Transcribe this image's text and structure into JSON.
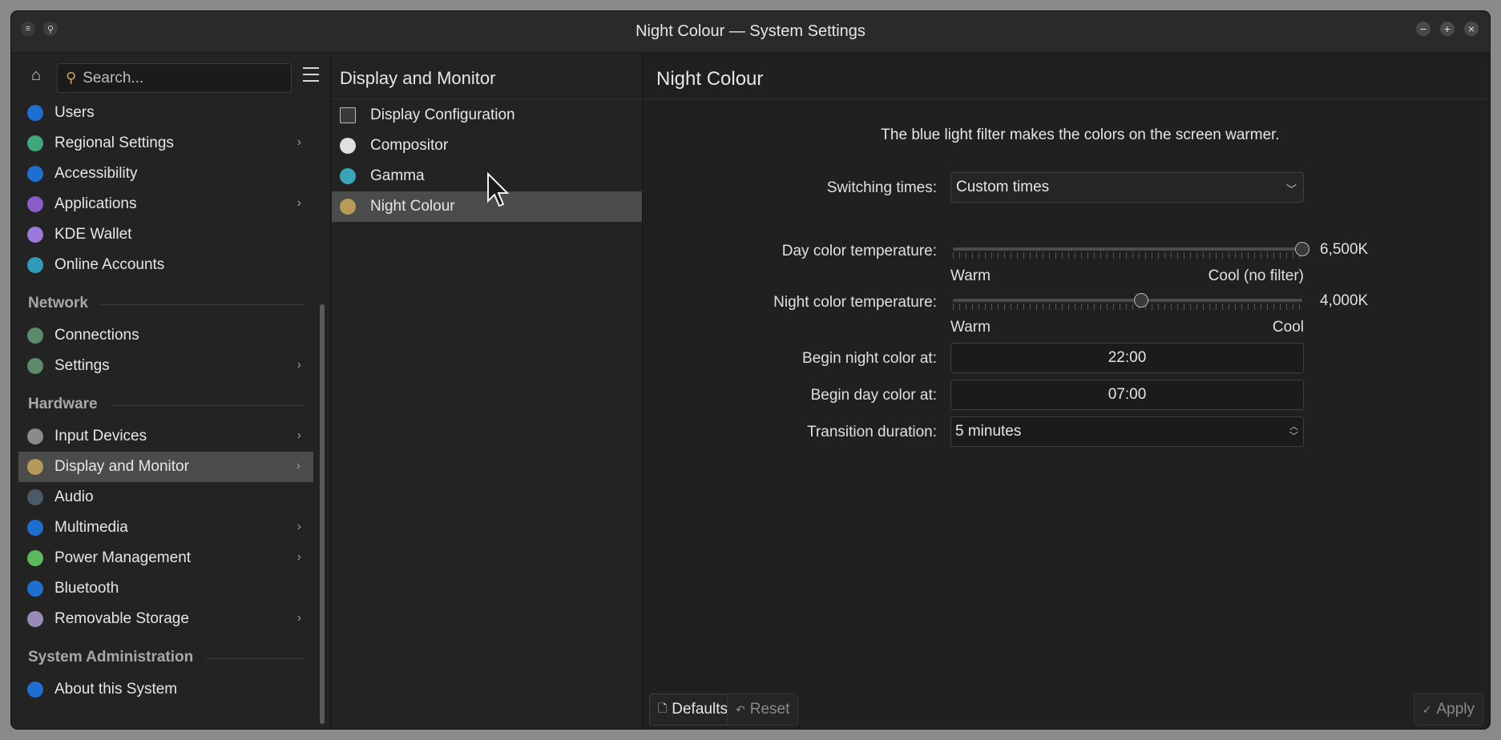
{
  "window": {
    "title": "Night Colour — System Settings"
  },
  "sidebar": {
    "search_placeholder": "Search...",
    "items": [
      {
        "label": "Users",
        "icon": "users-icon",
        "color": "#1e6fd0",
        "chevron": false
      },
      {
        "label": "Regional Settings",
        "icon": "globe-icon",
        "color": "#3fa77a",
        "chevron": true
      },
      {
        "label": "Accessibility",
        "icon": "accessibility-icon",
        "color": "#1e6fd0",
        "chevron": false
      },
      {
        "label": "Applications",
        "icon": "applications-icon",
        "color": "#8a5cc7",
        "chevron": true
      },
      {
        "label": "KDE Wallet",
        "icon": "wallet-icon",
        "color": "#9a7ad8",
        "chevron": false
      },
      {
        "label": "Online Accounts",
        "icon": "online-accounts-icon",
        "color": "#2f9bb8",
        "chevron": false
      }
    ],
    "sections": {
      "network": "Network",
      "hardware": "Hardware",
      "sysadmin": "System Administration"
    },
    "network_items": [
      {
        "label": "Connections",
        "icon": "network-icon",
        "color": "#5d8a6a",
        "chevron": false
      },
      {
        "label": "Settings",
        "icon": "network-settings-icon",
        "color": "#5d8a6a",
        "chevron": true
      }
    ],
    "hardware_items": [
      {
        "label": "Input Devices",
        "icon": "input-devices-icon",
        "color": "#8a8a8a",
        "chevron": true
      },
      {
        "label": "Display and Monitor",
        "icon": "display-icon",
        "color": "#b59a5a",
        "chevron": true,
        "selected": true
      },
      {
        "label": "Audio",
        "icon": "audio-icon",
        "color": "#4a5a66",
        "chevron": false
      },
      {
        "label": "Multimedia",
        "icon": "multimedia-icon",
        "color": "#1e6fd0",
        "chevron": true
      },
      {
        "label": "Power Management",
        "icon": "power-icon",
        "color": "#5cb85c",
        "chevron": true
      },
      {
        "label": "Bluetooth",
        "icon": "bluetooth-icon",
        "color": "#1e6fd0",
        "chevron": false
      },
      {
        "label": "Removable Storage",
        "icon": "removable-storage-icon",
        "color": "#9a8ab8",
        "chevron": true
      }
    ],
    "sysadmin_items": [
      {
        "label": "About this System",
        "icon": "info-icon",
        "color": "#1e6fd0",
        "chevron": false
      }
    ]
  },
  "middle": {
    "title": "Display and Monitor",
    "items": [
      {
        "label": "Display Configuration",
        "icon": "display-config-icon",
        "color": "#3a3a3a"
      },
      {
        "label": "Compositor",
        "icon": "compositor-icon",
        "color": "#e0e0e0"
      },
      {
        "label": "Gamma",
        "icon": "gamma-icon",
        "color": "#3aa6b8"
      },
      {
        "label": "Night Colour",
        "icon": "night-colour-icon",
        "color": "#b59a5a",
        "selected": true
      }
    ]
  },
  "main": {
    "title": "Night Colour",
    "description": "The blue light filter makes the colors on the screen warmer.",
    "switching_times_label": "Switching times:",
    "switching_times_value": "Custom times",
    "day_temp_label": "Day color temperature:",
    "day_temp_value": "6,500K",
    "day_temp_fraction": 1.0,
    "day_warm": "Warm",
    "day_cool": "Cool (no filter)",
    "night_temp_label": "Night color temperature:",
    "night_temp_value": "4,000K",
    "night_temp_fraction": 0.54,
    "night_warm": "Warm",
    "night_cool": "Cool",
    "begin_night_label": "Begin night color at:",
    "begin_night_value": "22:00",
    "begin_day_label": "Begin day color at:",
    "begin_day_value": "07:00",
    "transition_label": "Transition duration:",
    "transition_value": "5 minutes"
  },
  "footer": {
    "defaults": "Defaults",
    "reset": "Reset",
    "apply": "Apply"
  }
}
